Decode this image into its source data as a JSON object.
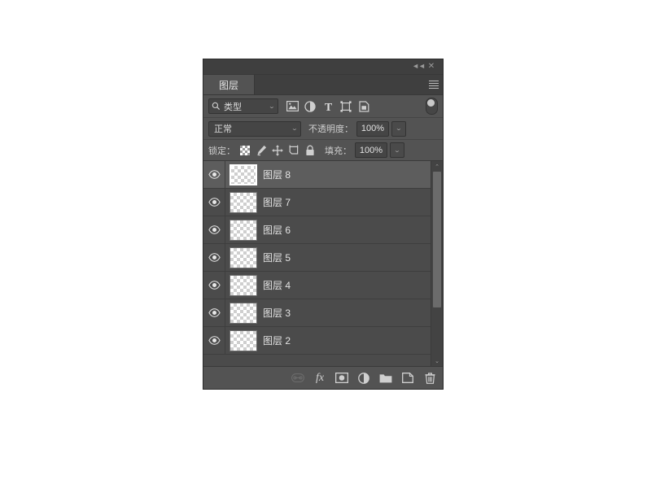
{
  "panel": {
    "tab_label": "图层",
    "titlebar": {
      "collapse_label": "◄◄",
      "close_label": "✕"
    },
    "menu_icon": "panel-menu-icon"
  },
  "filter_row": {
    "filter_kind_value": "类型",
    "search_icon": "search-icon",
    "chevron": "⌄",
    "icons": [
      {
        "name": "filter-pixel-icon",
        "title": "像素图层滤镜"
      },
      {
        "name": "filter-adjustment-icon",
        "title": "调整图层滤镜"
      },
      {
        "name": "filter-type-icon",
        "title": "文字图层滤镜"
      },
      {
        "name": "filter-shape-icon",
        "title": "形状图层滤镜"
      },
      {
        "name": "filter-smartobject-icon",
        "title": "智能对象滤镜"
      }
    ],
    "toggle_name": "filter-enable-toggle"
  },
  "blend_row": {
    "blend_mode": "正常",
    "opacity_label": "不透明度：",
    "opacity_value": "100%"
  },
  "lock_row": {
    "lock_label": "锁定：",
    "icons": [
      {
        "name": "lock-transparent-pixels-icon"
      },
      {
        "name": "lock-image-pixels-icon"
      },
      {
        "name": "lock-position-icon"
      },
      {
        "name": "lock-artboard-nesting-icon"
      },
      {
        "name": "lock-all-icon"
      }
    ],
    "fill_label": "填充：",
    "fill_value": "100%"
  },
  "layers": [
    {
      "name": "图层 8",
      "visible": true,
      "selected": true
    },
    {
      "name": "图层 7",
      "visible": true,
      "selected": false
    },
    {
      "name": "图层 6",
      "visible": true,
      "selected": false
    },
    {
      "name": "图层 5",
      "visible": true,
      "selected": false
    },
    {
      "name": "图层 4",
      "visible": true,
      "selected": false
    },
    {
      "name": "图层 3",
      "visible": true,
      "selected": false
    },
    {
      "name": "图层 2",
      "visible": true,
      "selected": false
    }
  ],
  "scrollbar": {
    "up_arrow": "⌃",
    "down_arrow": "⌄"
  },
  "bottom_bar": {
    "buttons": [
      {
        "name": "link-layers-button",
        "label": "链接图层",
        "disabled": true
      },
      {
        "name": "layer-style-button",
        "label": "fx"
      },
      {
        "name": "add-layer-mask-button",
        "label": "添加图层蒙版"
      },
      {
        "name": "new-adjustment-layer-button",
        "label": "创建新的填充或调整图层"
      },
      {
        "name": "new-group-button",
        "label": "创建新组"
      },
      {
        "name": "new-layer-button",
        "label": "创建新图层"
      },
      {
        "name": "delete-layer-button",
        "label": "删除图层"
      }
    ]
  },
  "colors": {
    "panel_bg": "#4b4b4b",
    "header_bg": "#535353",
    "tab_active": "#535353",
    "row_selected": "#5d5d5d",
    "text": "#e3e3e3",
    "icon": "#cfcfcf"
  }
}
